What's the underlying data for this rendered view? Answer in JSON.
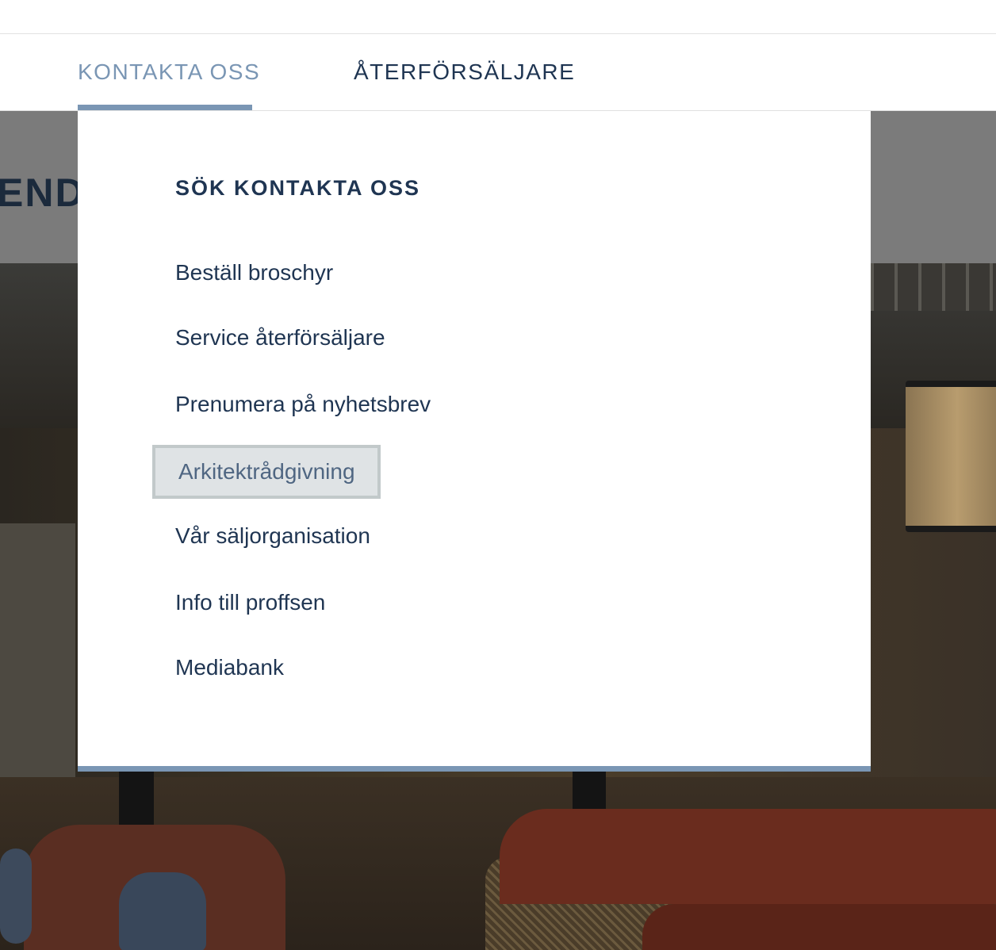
{
  "nav": {
    "items": [
      {
        "label": "KONTAKTA OSS",
        "active": true
      },
      {
        "label": "ÅTERFÖRSÄLJARE",
        "active": false
      }
    ],
    "accent_color": "#7a96b4",
    "text_color": "#1f3552"
  },
  "hero": {
    "heading_fragment": "END"
  },
  "dropdown": {
    "title": "SÖK KONTAKTA OSS",
    "items": [
      {
        "label": "Beställ broschyr"
      },
      {
        "label": "Service återförsäljare"
      },
      {
        "label": "Prenumera på nyhetsbrev"
      },
      {
        "label": "Arkitektrådgivning",
        "focused": true
      },
      {
        "label": "Vår säljorganisation"
      },
      {
        "label": "Info till proffsen"
      },
      {
        "label": "Mediabank"
      }
    ]
  }
}
